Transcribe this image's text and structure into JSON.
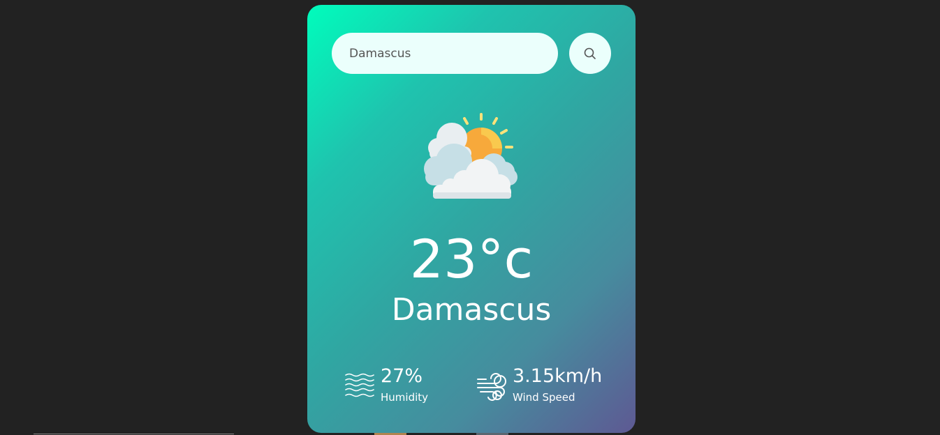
{
  "search": {
    "value": "Damascus",
    "icon": "search-icon"
  },
  "weather": {
    "icon": "sun-behind-clouds-icon",
    "temperature": "23°c",
    "city": "Damascus"
  },
  "details": {
    "humidity": {
      "icon": "humidity-waves-icon",
      "value": "27%",
      "label": "Humidity"
    },
    "wind": {
      "icon": "wind-icon",
      "value": "3.15km/h",
      "label": "Wind Speed"
    }
  },
  "colors": {
    "background": "#222222",
    "gradient_start": "#00fdbc",
    "gradient_end": "#5e5993",
    "input_background": "#ebfffc",
    "text": "#ffffff"
  }
}
